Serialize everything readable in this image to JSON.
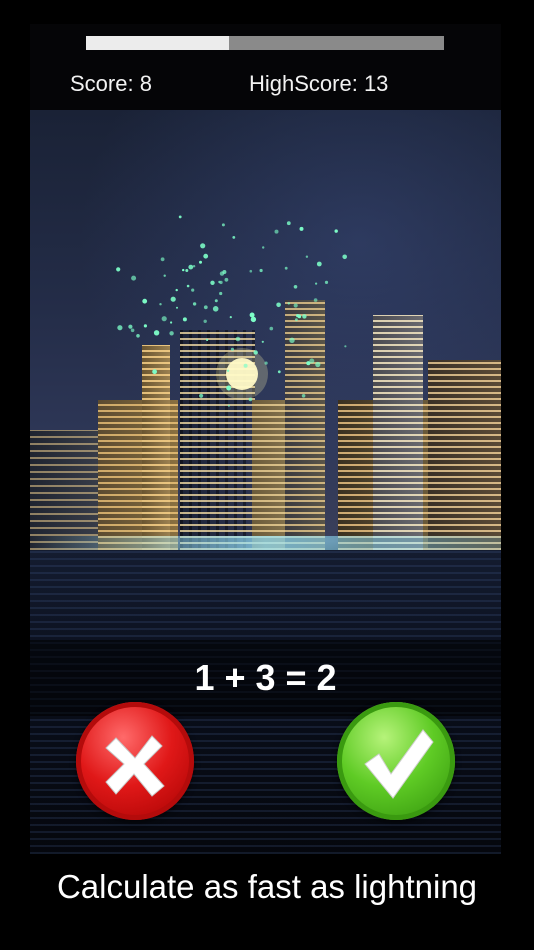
{
  "timer": {
    "progress": 0.4
  },
  "header": {
    "score_label": "Score: 8",
    "highscore_label": "HighScore: 13"
  },
  "game": {
    "equation": "1 + 3 = 2"
  },
  "buttons": {
    "wrong_icon": "cross-icon",
    "right_icon": "checkmark-icon",
    "wrong_color": "#e01818",
    "right_color": "#5fcb25"
  },
  "footer": {
    "tagline": "Calculate as fast as lightning"
  }
}
